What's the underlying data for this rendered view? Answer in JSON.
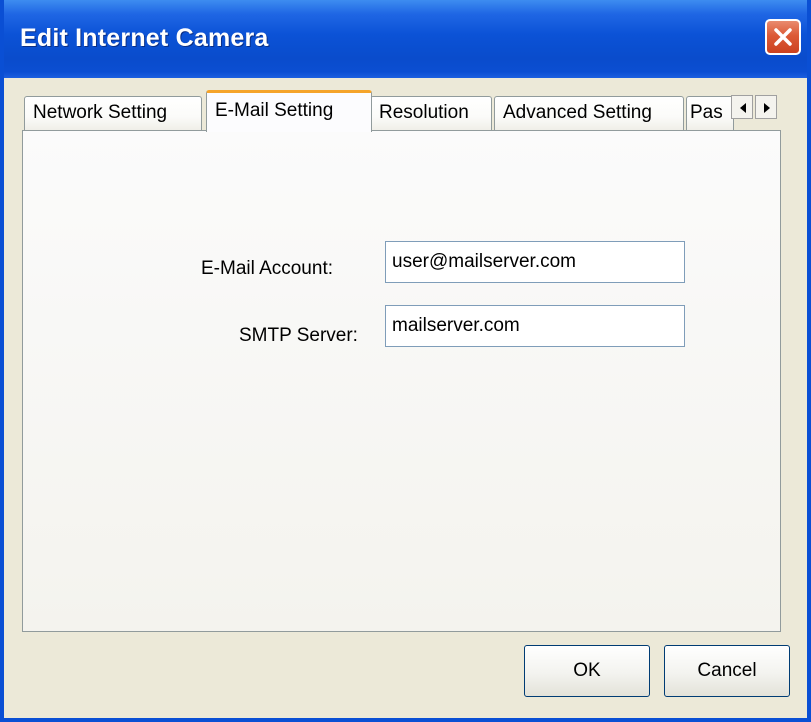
{
  "window": {
    "title": "Edit Internet Camera"
  },
  "tabs": [
    {
      "label": "Network Setting",
      "active": false
    },
    {
      "label": "E-Mail Setting",
      "active": true
    },
    {
      "label": "Resolution",
      "active": false
    },
    {
      "label": "Advanced Setting",
      "active": false
    },
    {
      "label": "Pas",
      "active": false
    }
  ],
  "form": {
    "email_label": "E-Mail Account:",
    "email_value": "user@mailserver.com",
    "smtp_label": "SMTP Server:",
    "smtp_value": "mailserver.com"
  },
  "buttons": {
    "ok": "OK",
    "cancel": "Cancel"
  },
  "icons": {
    "close": "close-icon",
    "tab_scroll_left": "arrow-left-icon",
    "tab_scroll_right": "arrow-right-icon"
  },
  "colors": {
    "titlebar": "#0b52d6",
    "close_button": "#dc5a36",
    "active_tab_accent": "#f5a42a",
    "dialog_background": "#ece9d8"
  }
}
